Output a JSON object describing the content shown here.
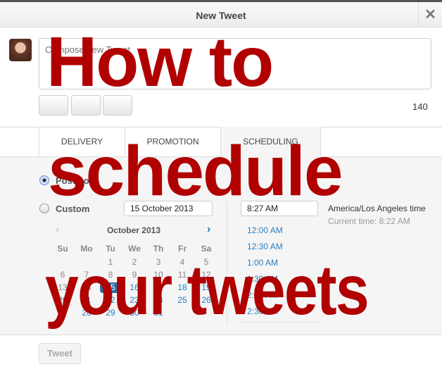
{
  "dialog": {
    "title": "New Tweet",
    "close_icon": "close-icon"
  },
  "compose": {
    "placeholder": "Compose new Tweet",
    "char_count": "140"
  },
  "tabs": [
    {
      "label": "DELIVERY"
    },
    {
      "label": "PROMOTION"
    },
    {
      "label": "SCHEDULING",
      "active": true
    }
  ],
  "scheduling": {
    "post_now_label": "Post now",
    "custom_label": "Custom",
    "selected": "post_now",
    "date_value": "15 October 2013",
    "time_value": "8:27 AM",
    "timezone": "America/Los Angeles time",
    "current_time": "Current time: 8:22 AM",
    "calendar": {
      "month": "October 2013",
      "weekdays": [
        "Su",
        "Mo",
        "Tu",
        "We",
        "Th",
        "Fr",
        "Sa"
      ],
      "weeks": [
        [
          "",
          "",
          "1",
          "2",
          "3",
          "4",
          "5"
        ],
        [
          "6",
          "7",
          "8",
          "9",
          "10",
          "11",
          "12"
        ],
        [
          "13",
          "14",
          "15",
          "16",
          "17",
          "18",
          "19"
        ],
        [
          "20",
          "21",
          "22",
          "23",
          "24",
          "25",
          "26"
        ],
        [
          "27",
          "28",
          "29",
          "30",
          "31",
          "",
          ""
        ]
      ],
      "selected_day": "15"
    },
    "time_options": [
      "12:00 AM",
      "12:30 AM",
      "1:00 AM",
      "1:30 AM",
      "2:00 AM",
      "2:30 AM"
    ]
  },
  "footer": {
    "tweet_label": "Tweet"
  },
  "overlay": {
    "line1": "How to",
    "line2": "schedule",
    "line3": "your tweets",
    "color": "#b00000"
  }
}
